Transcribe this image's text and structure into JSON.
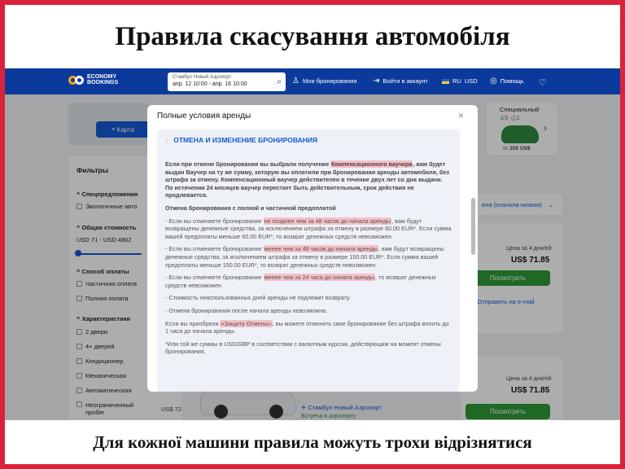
{
  "caption_top": "Правила скасування автомобіля",
  "caption_bottom": "Для кожної машини правила можуть трохи відрізнятися",
  "navbar": {
    "logo_line1": "ECONOMY",
    "logo_line2": "BOOKINGS",
    "search_location": "Стамбул Новый Аэропорт",
    "search_dates": "апр. 12 10:00 - апр. 16 10:00",
    "my_bookings": "Мои бронирования",
    "login": "Войти в аккаунт",
    "language": "RU",
    "currency": "USD",
    "help": "Помощь",
    "bg_color": "#0c3a9c"
  },
  "background": {
    "map_button": "Карта",
    "filters_title": "Фильтры",
    "special_offers": "Спецпредложения",
    "eco_cars": "Экологичные авто",
    "total_cost": "Общая стоимость",
    "price_range": "USD 71 - USD 4802",
    "payment_method": "Способ оплаты",
    "partial_payment": "Частичная оплата",
    "full_payment": "Полная оплата",
    "characteristics": "Характеристики",
    "two_doors": "2 двери",
    "four_doors": "4+ дверей",
    "ac": "Кондиционер",
    "manual": "Механическая",
    "automatic": "Автоматическая",
    "unlimited_mileage_1": "Неограниченный",
    "unlimited_mileage_2": "пробег",
    "price_side": "US$ 72",
    "category_name": "Специальный",
    "category_seats": "5",
    "category_bags": "1",
    "category_from": "от",
    "category_price": "205 US$",
    "sort": "ена (сначала низкая)",
    "price_for_days": "Цена за 4 дня/ей:",
    "price_value": "US$ 71.85",
    "view_button": "Посмотреть",
    "send_email": "Отправить на e-mail",
    "location": "Стамбул Новый Аэропорт",
    "meet_at_airport": "Встреча в аэропорту"
  },
  "modal": {
    "title": "Полные условия аренды",
    "close": "×",
    "section_title": "ОТМЕНА И ИЗМЕНЕНИЕ БРОНИРОВАНИЯ",
    "p1_a": "Если при отмене бронирования вы выбрали получение ",
    "p1_hl": "Компенсационного ваучера",
    "p1_b": ", вам будет выдан Ваучер на ту же сумму, которую вы оплатили при бронировании аренды автомобиля, без штрафа за отмену. Компенсационный ваучер действителен в течение двух лет со дня выдачи. По истечении 24 месяцев ваучер перестает быть действительным, срок действия не продлевается.",
    "p2": "Отмена бронирования с полной и частичной предоплатой",
    "p3_a": "- Если вы отменяете бронирование ",
    "p3_hl": "не позднее чем за 48 часов до начала аренды",
    "p3_b": ", вам будут возвращены денежные средства, за исключением штрафа за отмену в размере 60.00 EUR*. Если сумма вашей предоплаты меньше 60.00 EUR*, то возврат денежных средств невозможен.",
    "p4_a": "- Если вы отменяете бронирование ",
    "p4_hl": "менее чем за 48 часов до начала аренды",
    "p4_b": ", вам будут возвращены денежные средства, за исключением штрафа за отмену в размере 150.00 EUR*. Если сумма вашей предоплаты меньше 150.00 EUR*, то возврат денежных средств невозможен.",
    "p5_a": "- Если вы отменяете бронирование ",
    "p5_hl": "менее чем за 24 часа до начала аренды",
    "p5_b": ", то возврат денежных средств невозможен.",
    "p6": "- Стоимость неиспользованных дней аренды не подлежит возврату.",
    "p7": "- Отмена бронирования после начала аренды невозможна.",
    "p8_a": "Если вы приобрели ",
    "p8_hl": "«Защиту Отмены»",
    "p8_b": ", вы можете отменить свое бронирование без штрафа вплоть до 1 часа до начала аренды.",
    "p9": "*Или той же суммы в USD/GBP в соответствии с валютным курсом, действующим на момент отмены бронирования.",
    "highlight_color": "#f6c1c6"
  }
}
